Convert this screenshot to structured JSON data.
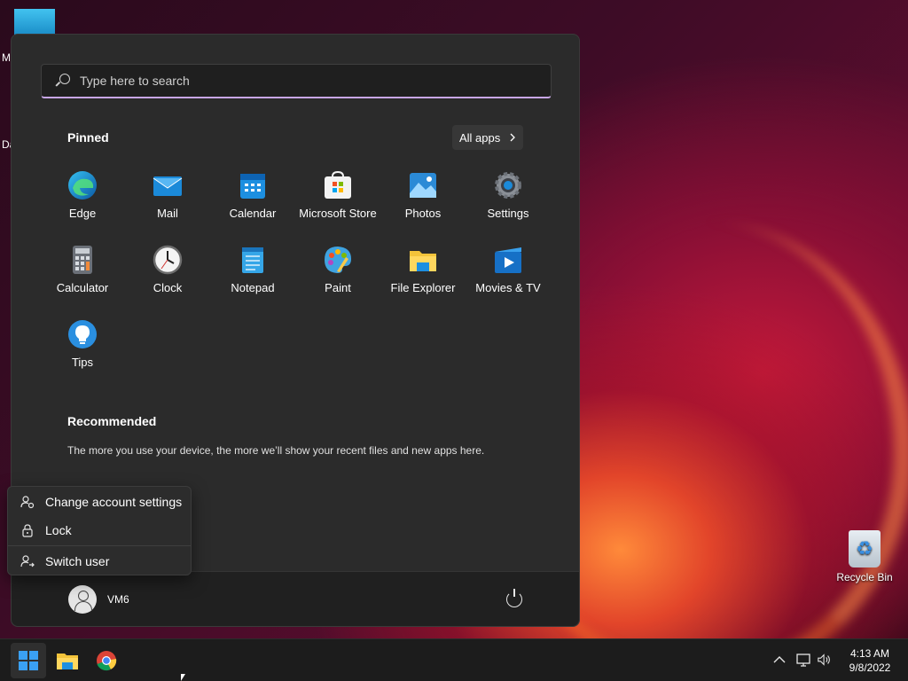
{
  "start_menu": {
    "search": {
      "placeholder": "Type here to search"
    },
    "pinned": {
      "title": "Pinned",
      "all_apps_label": "All apps",
      "apps": [
        {
          "label": "Edge",
          "icon": "edge-icon"
        },
        {
          "label": "Mail",
          "icon": "mail-icon"
        },
        {
          "label": "Calendar",
          "icon": "calendar-icon"
        },
        {
          "label": "Microsoft Store",
          "icon": "store-icon"
        },
        {
          "label": "Photos",
          "icon": "photos-icon"
        },
        {
          "label": "Settings",
          "icon": "settings-icon"
        },
        {
          "label": "Calculator",
          "icon": "calculator-icon"
        },
        {
          "label": "Clock",
          "icon": "clock-icon"
        },
        {
          "label": "Notepad",
          "icon": "notepad-icon"
        },
        {
          "label": "Paint",
          "icon": "paint-icon"
        },
        {
          "label": "File Explorer",
          "icon": "file-explorer-icon"
        },
        {
          "label": "Movies & TV",
          "icon": "movies-tv-icon"
        },
        {
          "label": "Tips",
          "icon": "tips-icon"
        }
      ]
    },
    "recommended": {
      "title": "Recommended",
      "text": "The more you use your device, the more we’ll show your recent files and new apps here."
    },
    "user": {
      "name": "VM6"
    }
  },
  "account_flyout": {
    "items": [
      {
        "label": "Change account settings",
        "icon": "account-settings-icon"
      },
      {
        "label": "Lock",
        "icon": "lock-icon"
      },
      {
        "label": "Switch user",
        "icon": "switch-user-icon"
      }
    ]
  },
  "desktop": {
    "recycle_bin_label": "Recycle Bin",
    "edge_labels": [
      "M",
      "Da"
    ]
  },
  "taskbar": {
    "time": "4:13 AM",
    "date": "9/8/2022"
  },
  "colors": {
    "accent": "#c8a6e6",
    "start_bg": "#2b2b2b",
    "taskbar_bg": "#1c1c1c"
  }
}
